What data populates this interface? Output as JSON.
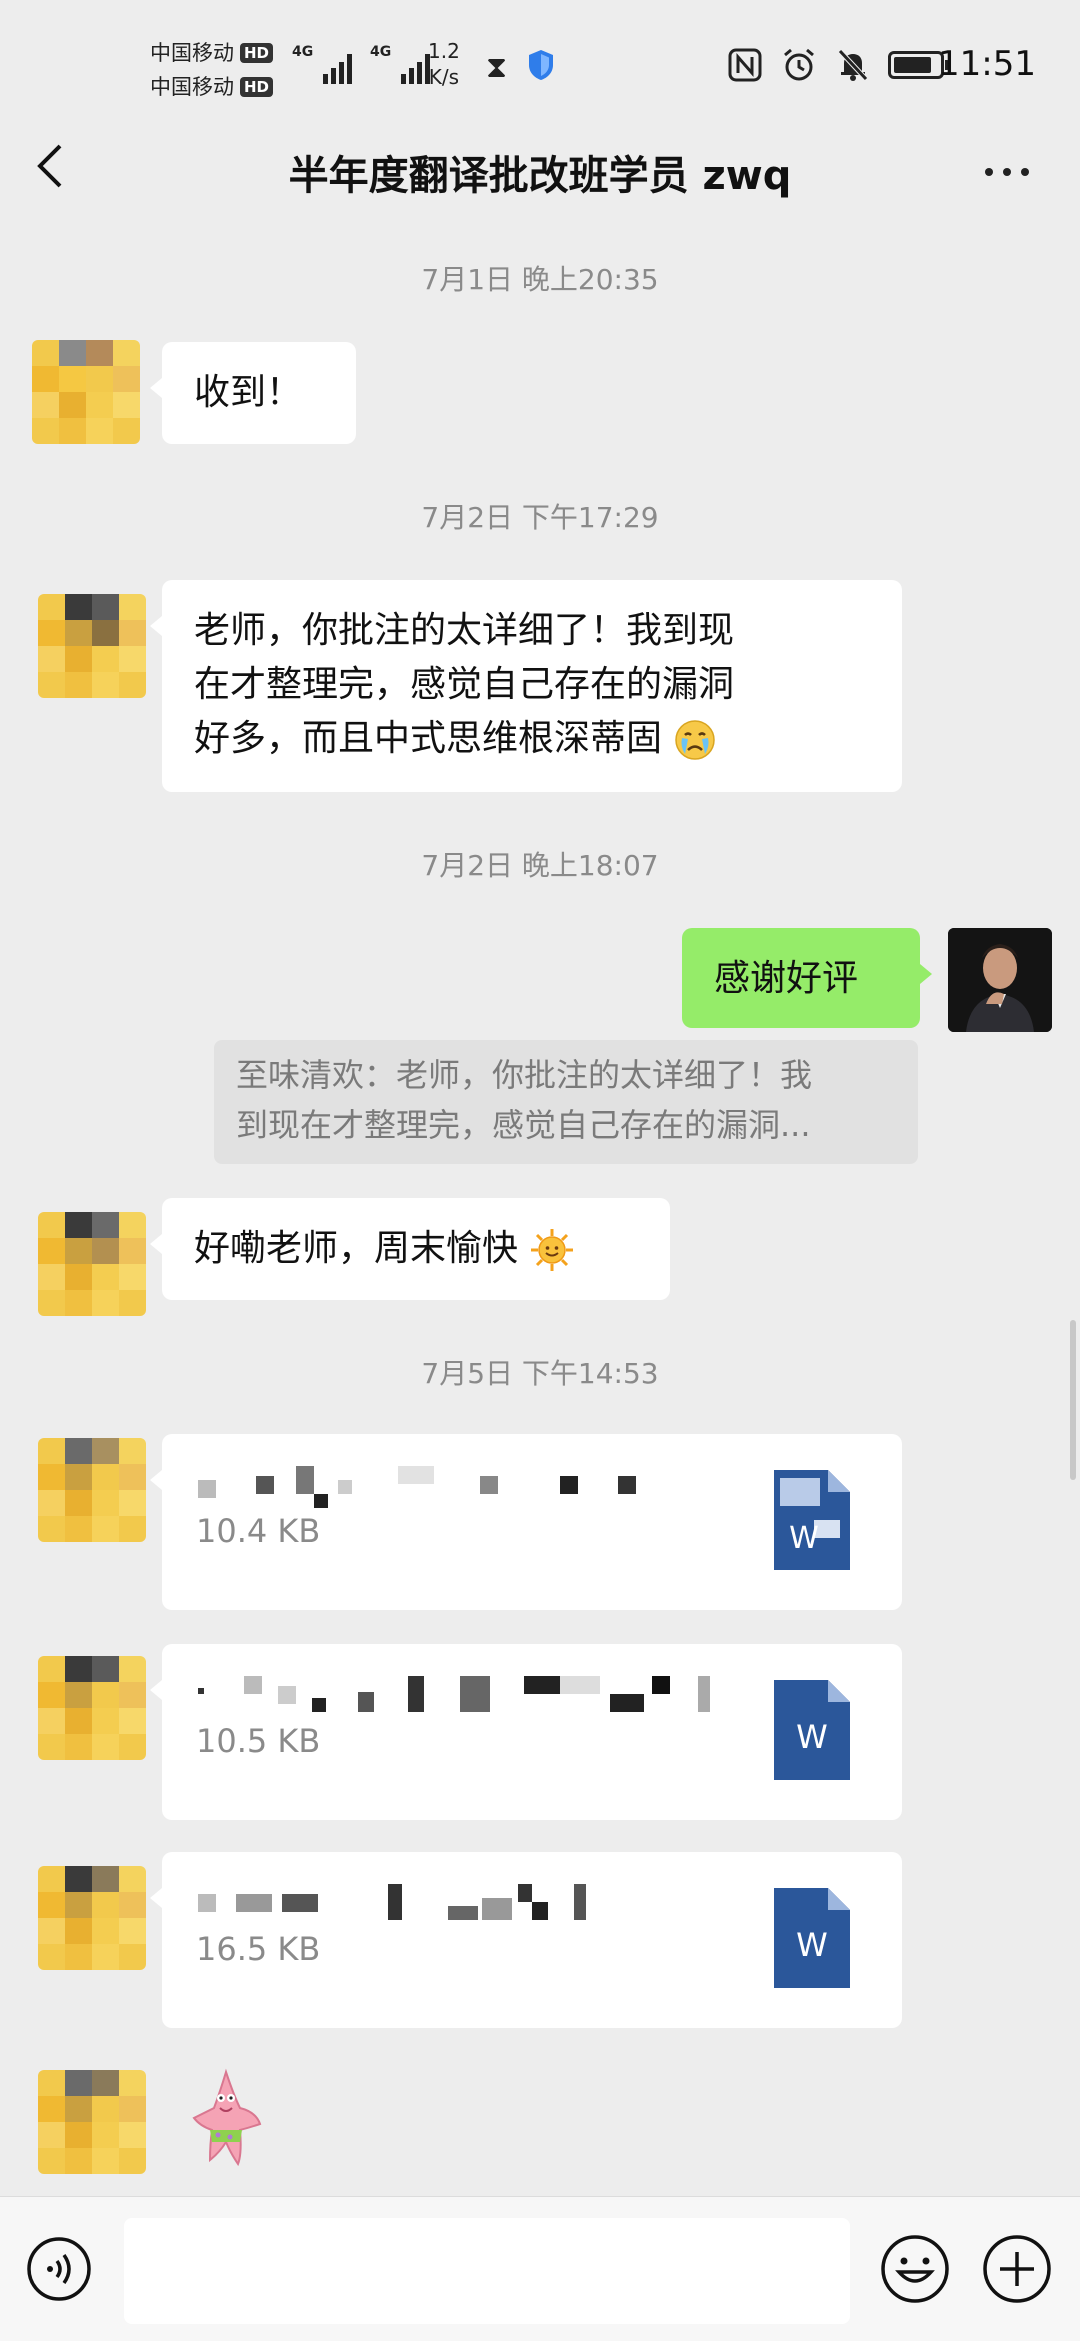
{
  "status_bar": {
    "carrier_1": "中国移动",
    "carrier_2": "中国移动",
    "hd_badge": "HD",
    "network_1": "4G",
    "network_2": "4G",
    "speed_value": "1.2",
    "speed_unit": "K/s",
    "time": "11:51",
    "battery_level": 0.85,
    "icons": [
      "nfc-icon",
      "alarm-icon",
      "mute-bell-icon",
      "battery-icon",
      "hourglass-icon",
      "shield-icon"
    ]
  },
  "header": {
    "title": "半年度翻译批改班学员 zwq",
    "back_icon": "chevron-left-icon",
    "more_icon": "more-dots-icon"
  },
  "messages": {
    "ts1": "7月1日 晚上20:35",
    "m1": "收到！",
    "ts2": "7月2日 下午17:29",
    "m2_l1": "老师，你批注的太详细了！我到现",
    "m2_l2": "在才整理完，感觉自己存在的漏洞",
    "m2_l3": "好多，而且中式思维根深蒂固",
    "ts3": "7月2日 晚上18:07",
    "m3": "感谢好评",
    "quote_l1": "至味清欢：老师，你批注的太详细了！我",
    "quote_l2": "到现在才整理完，感觉自己存在的漏洞...",
    "m4": "好嘞老师，周末愉快",
    "ts4": "7月5日 下午14:53",
    "file1_size": "10.4 KB",
    "file2_size": "10.5 KB",
    "file3_size": "16.5 KB",
    "file_icon": "word-doc-icon",
    "doc_letter": "W"
  },
  "input_bar": {
    "voice_icon": "voice-icon",
    "emoji_icon": "emoji-smile-icon",
    "plus_icon": "plus-circle-icon"
  },
  "colors": {
    "background": "#ededed",
    "bubble_in": "#ffffff",
    "bubble_out": "#95ec69",
    "word_blue": "#2b579a"
  }
}
